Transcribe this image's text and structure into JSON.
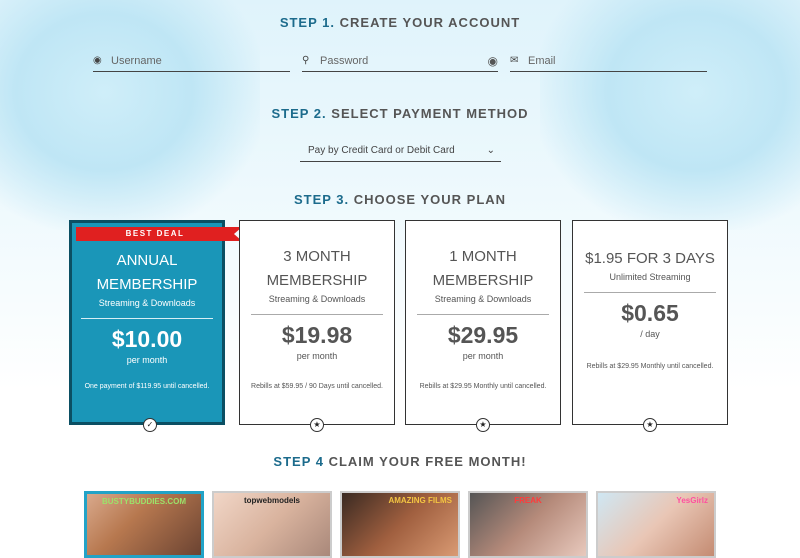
{
  "step1": {
    "num": "STEP 1.",
    "title": "CREATE YOUR ACCOUNT"
  },
  "account": {
    "username_placeholder": "Username",
    "password_placeholder": "Password",
    "email_placeholder": "Email"
  },
  "step2": {
    "num": "STEP 2.",
    "title": "SELECT PAYMENT METHOD"
  },
  "payment": {
    "selected": "Pay by Credit Card or Debit Card"
  },
  "step3": {
    "num": "STEP 3.",
    "title": "CHOOSE YOUR PLAN"
  },
  "plans": [
    {
      "ribbon": "BEST DEAL",
      "name1": "ANNUAL",
      "name2": "MEMBERSHIP",
      "sub": "Streaming & Downloads",
      "price": "$10.00",
      "per": "per month",
      "note": "One payment of $119.95 until cancelled."
    },
    {
      "name1": "3 MONTH",
      "name2": "MEMBERSHIP",
      "sub": "Streaming & Downloads",
      "price": "$19.98",
      "per": "per month",
      "note": "Rebills at $59.95 / 90 Days until cancelled."
    },
    {
      "name1": "1 MONTH",
      "name2": "MEMBERSHIP",
      "sub": "Streaming & Downloads",
      "price": "$29.95",
      "per": "per month",
      "note": "Rebills at $29.95 Monthly until cancelled."
    },
    {
      "name1": "$1.95 FOR 3 DAYS",
      "sub": "Unlimited Streaming",
      "price": "$0.65",
      "per": "/ day",
      "note": "Rebills at $29.95 Monthly until cancelled."
    }
  ],
  "step4": {
    "num": "STEP 4",
    "title": "CLAIM YOUR FREE MONTH!"
  },
  "sites": [
    {
      "logo": "BUSTYBUDDIES.COM"
    },
    {
      "logo": "topwebmodels"
    },
    {
      "logo": "AMAZING FILMS"
    },
    {
      "logo": "FREAK"
    },
    {
      "logo": "YesGirlz"
    }
  ],
  "colors": {
    "accent": "#1a96b8",
    "accent_dark": "#0b4f63",
    "ribbon": "#e02020",
    "step_num": "#1c6b8c"
  }
}
